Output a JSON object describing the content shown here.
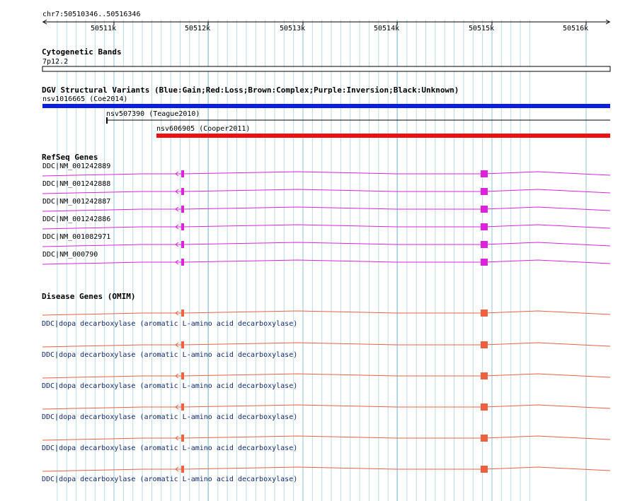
{
  "ruler": {
    "location": "chr7:50510346..50516346",
    "ticks": [
      "50511k",
      "50512k",
      "50513k",
      "50514k",
      "50515k",
      "50516k"
    ]
  },
  "cytobands": {
    "title": "Cytogenetic Bands",
    "band": "7p12.2"
  },
  "dgv": {
    "title": "DGV Structural Variants (Blue:Gain;Red:Loss;Brown:Complex;Purple:Inversion;Black:Unknown)",
    "variants": [
      {
        "label": "nsv1016665 (Coe2014)",
        "color": "#0b1fe0"
      },
      {
        "label": "nsv507390 (Teague2010)",
        "color": "#000000"
      },
      {
        "label": "nsv606905 (Cooper2011)",
        "color": "#ee1111"
      }
    ]
  },
  "refseq": {
    "title": "RefSeq Genes",
    "color": "#dd22dd",
    "genes": [
      "DDC|NM_001242889",
      "DDC|NM_001242888",
      "DDC|NM_001242887",
      "DDC|NM_001242886",
      "DDC|NM_001082971",
      "DDC|NM_000790"
    ]
  },
  "omim": {
    "title": "Disease Genes (OMIM)",
    "color": "#ee6040",
    "genes": [
      "DDC|dopa decarboxylase (aromatic L-amino acid decarboxylase)",
      "DDC|dopa decarboxylase (aromatic L-amino acid decarboxylase)",
      "DDC|dopa decarboxylase (aromatic L-amino acid decarboxylase)",
      "DDC|dopa decarboxylase (aromatic L-amino acid decarboxylase)",
      "DDC|dopa decarboxylase (aromatic L-amino acid decarboxylase)",
      "DDC|dopa decarboxylase (aromatic L-amino acid decarboxylase)"
    ]
  },
  "colors": {
    "grid_minor": "#b9dbe4",
    "grid_major": "#8fc3d3"
  }
}
